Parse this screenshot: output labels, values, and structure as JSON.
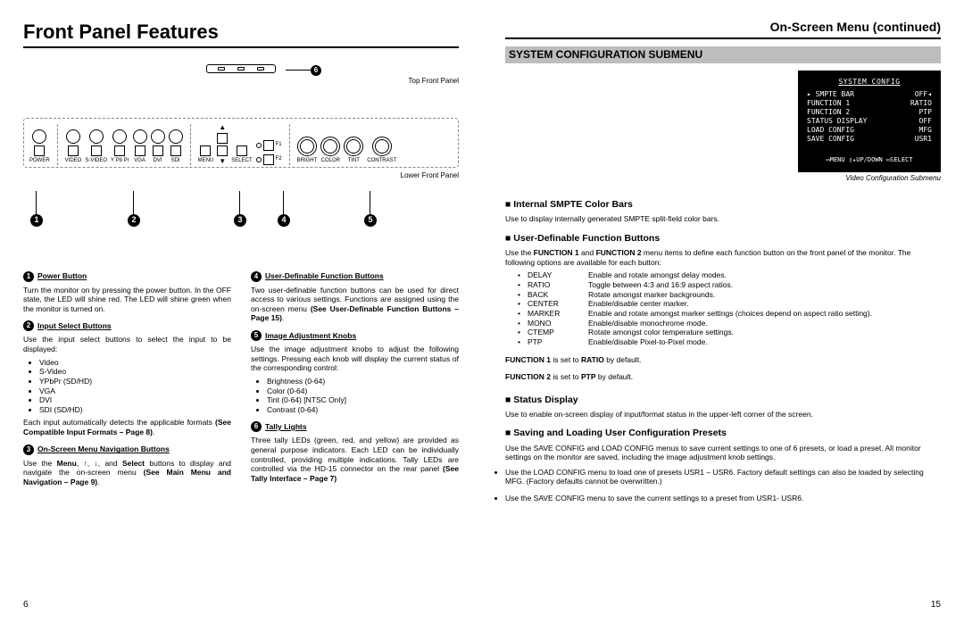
{
  "left": {
    "title": "Front Panel Features",
    "topPanelLabel": "Top Front Panel",
    "lowerPanelLabel": "Lower Front Panel",
    "labels": {
      "power": "POWER",
      "video": "VIDEO",
      "svideo": "S-VIDEO",
      "ypbpr": "Y Pb Pr",
      "vga": "VGA",
      "dvi": "DVI",
      "sdi": "SDI",
      "menu": "MENU",
      "select": "SELECT",
      "f1": "F1",
      "f2": "F2",
      "bright": "BRIGHT",
      "color": "COLOR",
      "tint": "TINT",
      "contrast": "CONTRAST"
    },
    "callouts": {
      "c1": "1",
      "c2": "2",
      "c3": "3",
      "c4": "4",
      "c5": "5",
      "c6": "6"
    },
    "items": {
      "i1": {
        "num": "1",
        "head": "Power Button",
        "body": "Turn the monitor on by pressing the power button. In the OFF state, the LED will shine red. The LED will shine green when the monitor is turned on."
      },
      "i2": {
        "num": "2",
        "head": "Input Select Buttons",
        "body": "Use the input select buttons to select the input to be displayed:",
        "list": [
          "Video",
          "S-Video",
          "YPbPr (SD/HD)",
          "VGA",
          "DVI",
          "SDI (SD/HD)"
        ],
        "tail": "Each input automatically detects the applicable formats ",
        "tailBold": "(See Compatible Input Formats – Page 8)",
        "tailEnd": "."
      },
      "i3": {
        "num": "3",
        "head": "On-Screen Menu Navigation Buttons",
        "body": "Use the ",
        "bodyBold1": "Menu",
        "body2": ", ↑, ↓, and ",
        "bodyBold2": "Select",
        "body3": " buttons to display and navigate the on-screen menu ",
        "bodyBold3": "(See Main Menu and Navigation – Page 9)",
        "body4": "."
      },
      "i4": {
        "num": "4",
        "head": "User-Definable Function Buttons",
        "body": "Two user-definable function buttons can be used for direct access to various settings. Functions are assigned using the on-screen menu ",
        "bodyBold": "(See User-Definable Function Buttons – Page 15)",
        "bodyEnd": "."
      },
      "i5": {
        "num": "5",
        "head": "Image Adjustment Knobs",
        "body": "Use the image adjustment knobs to adjust the following settings. Pressing each knob will display the current status of the corresponding control:",
        "list": [
          "Brightness (0-64)",
          "Color (0-64)",
          "Tint (0-64) [NTSC Only]",
          "Contrast (0-64)"
        ]
      },
      "i6": {
        "num": "6",
        "head": "Tally Lights",
        "body": "Three tally LEDs (green, red, and yellow) are provided as general purpose indicators. Each LED can be individually controlled, providing multiple indications. Tally LEDs are controlled via the HD-15 connector on the rear panel ",
        "bodyBold": "(See Tally Interface – Page 7)"
      }
    },
    "pageNum": "6"
  },
  "right": {
    "title": "On-Screen Menu (continued)",
    "barTitle": "SYSTEM CONFIGURATION SUBMENU",
    "osd": {
      "title": "SYSTEM CONFIG",
      "rows": [
        {
          "k": "▸ SMPTE BAR",
          "v": "OFF◂"
        },
        {
          "k": "  FUNCTION 1",
          "v": "RATIO"
        },
        {
          "k": "  FUNCTION 2",
          "v": "PTP"
        },
        {
          "k": "  STATUS DISPLAY",
          "v": "OFF"
        },
        {
          "k": "  LOAD CONFIG",
          "v": "MFG"
        },
        {
          "k": "  SAVE CONFIG",
          "v": "USR1"
        }
      ],
      "foot": "▭MENU ▯▴UP/DOWN ▭SELECT",
      "cap": "Video Configuration Submenu"
    },
    "s1": {
      "head": "Internal SMPTE Color Bars",
      "body": "Use to display internally generated SMPTE split-field color bars."
    },
    "s2": {
      "head": "User-Definable Function Buttons",
      "p1a": "Use the ",
      "p1b": "FUNCTION 1",
      "p1c": " and ",
      "p1d": "FUNCTION 2",
      "p1e": " menu items to define each function button on the front panel of the monitor. The following options are available for each button:",
      "opts": [
        {
          "k": "DELAY",
          "v": "Enable and rotate amongst delay modes."
        },
        {
          "k": "RATIO",
          "v": "Toggle between 4:3 and 16:9 aspect ratios."
        },
        {
          "k": "BACK",
          "v": "Rotate amongst marker backgrounds."
        },
        {
          "k": "CENTER",
          "v": "Enable/disable center marker."
        },
        {
          "k": "MARKER",
          "v": "Enable and rotate amongst marker settings (choices depend on aspect ratio setting)."
        },
        {
          "k": "MONO",
          "v": "Enable/disable monochrome mode."
        },
        {
          "k": "CTEMP",
          "v": "Rotate amongst color temperature settings."
        },
        {
          "k": "PTP",
          "v": "Enable/disable Pixel-to-Pixel mode."
        }
      ],
      "n1a": "FUNCTION 1",
      "n1b": " is set to ",
      "n1c": "RATIO",
      "n1d": " by default.",
      "n2a": "FUNCTION 2",
      "n2b": " is set to ",
      "n2c": "PTP",
      "n2d": " by default."
    },
    "s3": {
      "head": "Status Display",
      "body": "Use to enable on-screen display of input/format status in the upper-left corner of the screen."
    },
    "s4": {
      "head": "Saving and Loading User Configuration Presets",
      "p": "Use the SAVE CONFIG and LOAD CONFIG menus to save current settings to one of 6 presets, or load a preset.  All monitor settings on the monitor are saved, including the image adjustment knob settings.",
      "b1": "Use the LOAD CONFIG menu to load one of presets USR1 – USR6. Factory default settings can also be loaded by selecting MFG. (Factory defaults cannot be overwritten.)",
      "b2": "Use the SAVE CONFIG menu to save the current settings to a preset from USR1- USR6."
    },
    "pageNum": "15"
  }
}
